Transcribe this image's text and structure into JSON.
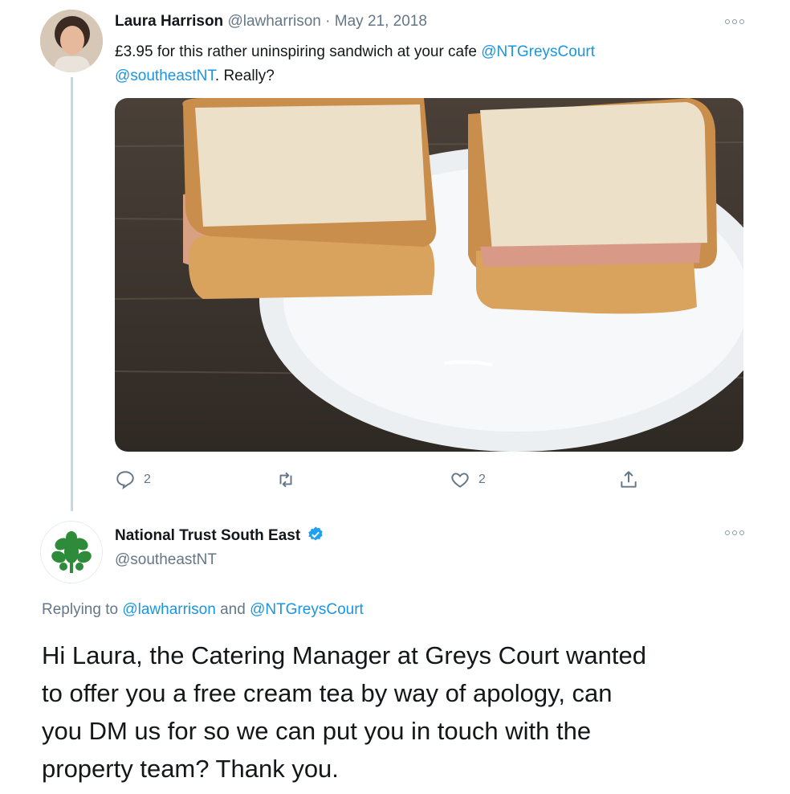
{
  "tweet": {
    "author_name": "Laura Harrison",
    "handle": "@lawharrison",
    "separator": "·",
    "date": "May 21, 2018",
    "text_line1": "£3.95 for this rather uninspiring sandwich at your cafe ",
    "mention1": "@NTGreysCourt",
    "mention2": "@southeastNT",
    "text_end": ". Really?",
    "reply_count": "2",
    "like_count": "2",
    "icons": [
      "reply-icon",
      "retweet-icon",
      "like-icon",
      "share-icon",
      "more-icon"
    ]
  },
  "reply": {
    "author_name": "National Trust South East",
    "handle": "@southeastNT",
    "replying_prefix": "Replying to ",
    "replying_mention1": "@lawharrison",
    "replying_and": " and ",
    "replying_mention2": "@NTGreysCourt",
    "text_line1": "Hi Laura, the Catering Manager at Greys Court wanted",
    "text_line2": "to offer you a free cream tea by way of apology, can",
    "text_line3": "you DM us for so we can put you in touch with the",
    "text_line4": "property team? Thank you.",
    "icons": [
      "verified-badge-icon",
      "oak-leaf-logo-icon",
      "more-icon"
    ]
  },
  "colors": {
    "link": "#1b95e0",
    "secondary": "#657786",
    "verified": "#1da1f2",
    "logo_green": "#2e8b3a"
  }
}
